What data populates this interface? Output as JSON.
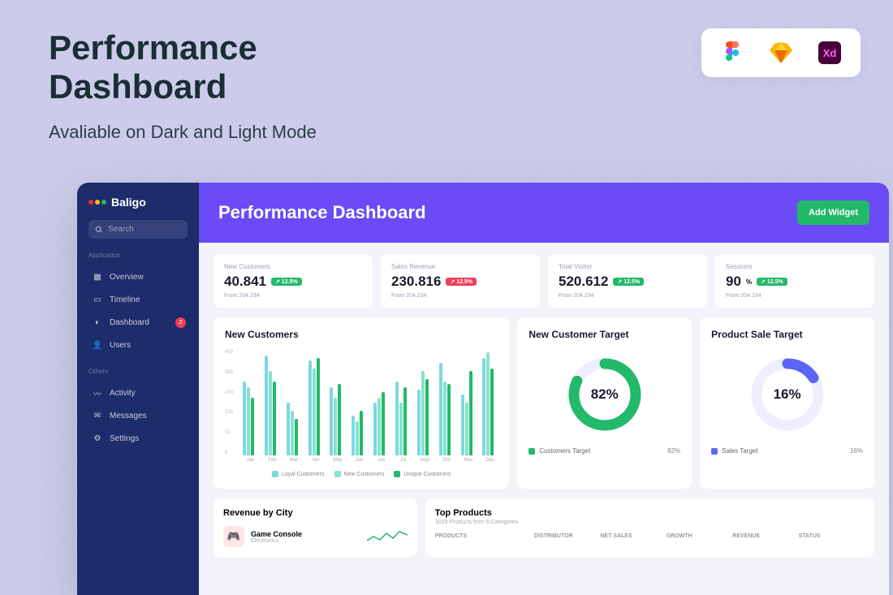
{
  "promo": {
    "title_l1": "Performance",
    "title_l2": "Dashboard",
    "subtitle": "Avaliable on Dark and Light Mode"
  },
  "tools": [
    "figma",
    "sketch",
    "xd"
  ],
  "brand": {
    "name": "Baligo"
  },
  "search": {
    "placeholder": "Search"
  },
  "nav": {
    "section1_label": "Application",
    "section2_label": "Others",
    "items1": [
      {
        "label": "Overview",
        "icon": "grid"
      },
      {
        "label": "Timeline",
        "icon": "calendar"
      },
      {
        "label": "Dashboard",
        "icon": "pie",
        "badge": "2"
      },
      {
        "label": "Users",
        "icon": "user"
      }
    ],
    "items2": [
      {
        "label": "Activity",
        "icon": "activity"
      },
      {
        "label": "Messages",
        "icon": "message"
      },
      {
        "label": "Settings",
        "icon": "gear"
      }
    ]
  },
  "page_title": "Performance Dashboard",
  "add_btn": "Add Widget",
  "stats": [
    {
      "label": "New Customers",
      "value": "40.841",
      "delta": "↗ 12.5%",
      "delta_type": "green",
      "from": "From 204.234"
    },
    {
      "label": "Sales Revenue",
      "value": "230.816",
      "delta": "↗ 12.5%",
      "delta_type": "red",
      "from": "From 204.234"
    },
    {
      "label": "Total Visitor",
      "value": "520.612",
      "delta": "↗ 12.5%",
      "delta_type": "green",
      "from": "From 204.234"
    },
    {
      "label": "Sessions",
      "value": "90",
      "pct": "%",
      "delta": "↗ 12.5%",
      "delta_type": "green",
      "from": "From 204.234"
    }
  ],
  "chart_data": [
    {
      "type": "bar",
      "title": "New Customers",
      "categories": [
        "Jan",
        "Feb",
        "Mar",
        "Apr",
        "May",
        "Jun",
        "Jun",
        "Jul",
        "Sept",
        "Oct",
        "Nov",
        "Des"
      ],
      "series": [
        {
          "name": "Loyal Customers",
          "color": "#7dd8e0",
          "values": [
            280,
            380,
            200,
            360,
            260,
            150,
            200,
            280,
            250,
            350,
            230,
            370
          ]
        },
        {
          "name": "New Customers",
          "color": "#85e2d0",
          "values": [
            260,
            320,
            170,
            330,
            220,
            130,
            220,
            200,
            320,
            280,
            200,
            390
          ]
        },
        {
          "name": "Unique Customers",
          "color": "#22b96a",
          "values": [
            220,
            280,
            140,
            370,
            270,
            170,
            240,
            260,
            290,
            270,
            320,
            330
          ]
        }
      ],
      "y_ticks": [
        "400",
        "300",
        "200",
        "100",
        "50",
        "0"
      ],
      "ylim": [
        0,
        400
      ]
    },
    {
      "type": "donut",
      "title": "New Customer Target",
      "value": 82,
      "display": "82%",
      "legend": "Customers Target",
      "legend_value": "82%",
      "color": "#22b96a"
    },
    {
      "type": "donut",
      "title": "Product Sale Target",
      "value": 16,
      "display": "16%",
      "legend": "Sales Target",
      "legend_value": "16%",
      "color": "#5b65f5"
    }
  ],
  "revenue": {
    "title": "Revenue by City",
    "items": [
      {
        "name": "Game Console",
        "category": "Electronics",
        "icon": "🎮"
      }
    ]
  },
  "top_products": {
    "title": "Top Products",
    "subtitle": "3029 Products from 6 Categories",
    "columns": [
      "PRODUCTS",
      "DISTRIBUTOR",
      "NET SALES",
      "GROWTH",
      "REVENUE",
      "STATUS"
    ]
  },
  "colors": {
    "c_loyal": "#7dd8e0",
    "c_new": "#85e2d0",
    "c_unique": "#22b96a",
    "c_blue": "#5b65f5"
  }
}
